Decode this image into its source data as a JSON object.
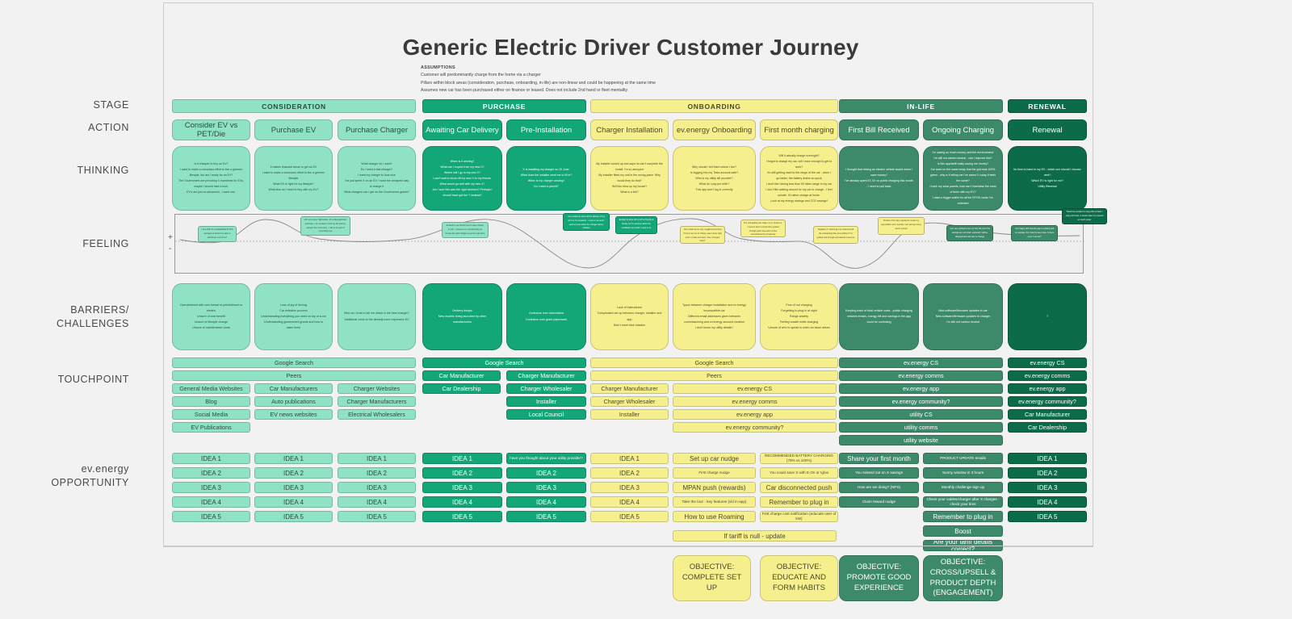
{
  "header": {
    "title": "Generic Electric Driver Customer Journey",
    "assumptions_heading": "ASSUMPTIONS",
    "assumptions": [
      "Customer will predominantly charge from the home via a charger",
      "Pillars within block areas (consideration, purchase, onboarding, in-life) are non-linear and could be happening at the same time",
      "Assumes new car has been purchased either on finance or leased. Does not include 2nd hand or fleet mentality"
    ]
  },
  "row_labels": {
    "stage": "STAGE",
    "action": "ACTION",
    "thinking": "THINKING",
    "feeling": "FEELING",
    "barriers": "BARRIERS/\nCHALLENGES",
    "touchpoint": "TOUCHPOINT",
    "opportunity": "ev.energy\nOPPORTUNITY"
  },
  "colors": {
    "mint": "#8fe3c4",
    "green": "#12a678",
    "yellow": "#f6ef8e",
    "sage": "#3d8a6b",
    "dark": "#0c6b49",
    "board_bg": "#f2f2f2"
  },
  "stages": [
    {
      "label": "CONSIDERATION",
      "theme": "mint"
    },
    {
      "label": "PURCHASE",
      "theme": "green"
    },
    {
      "label": "ONBOARDING",
      "theme": "yellow"
    },
    {
      "label": "IN-LIFE",
      "theme": "sage"
    },
    {
      "label": "RENEWAL",
      "theme": "dark"
    }
  ],
  "actions": [
    {
      "label": "Consider EV vs PET/Die",
      "theme": "mint"
    },
    {
      "label": "Purchase EV",
      "theme": "mint"
    },
    {
      "label": "Purchase Charger",
      "theme": "mint"
    },
    {
      "label": "Awaiting Car Delivery",
      "theme": "green"
    },
    {
      "label": "Pre-Installation",
      "theme": "green"
    },
    {
      "label": "Charger Installation",
      "theme": "yellow"
    },
    {
      "label": "ev.energy Onboarding",
      "theme": "yellow"
    },
    {
      "label": "First month charging",
      "theme": "yellow"
    },
    {
      "label": "First Bill Received",
      "theme": "sage"
    },
    {
      "label": "Ongoing Charging",
      "theme": "sage"
    },
    {
      "label": "Renewal",
      "theme": "dark"
    }
  ],
  "thinking": [
    {
      "theme": "mint",
      "lines": [
        "Is it cheaper to buy an EV?",
        "I want to make a conscious effort to live a greener lifestyle, but am I ready for an EV?",
        "The Government are providing X incentives for EVs, maybe I should take a look.",
        "EV's are just so advanced - I want one."
      ]
    },
    {
      "theme": "mint",
      "lines": [
        "It makes financial sense to get an EV",
        "I want to make a conscious effort to live a greener lifestyle",
        "What EV is right for my lifestyle?",
        "What else do I need to buy with my EV?"
      ]
    },
    {
      "theme": "mint",
      "lines": [
        "What charger do I want?",
        "Do I need a fast charger?",
        "I want my charger to look nice",
        "I've just spent X on an EV, I want the cheapest way to charge it",
        "What chargers can I get on the Government grants?"
      ]
    },
    {
      "theme": "green",
      "lines": [
        "When is it arriving?",
        "What can I expect from my new X?",
        "Where will I go in my new X?",
        "I can't wait to show off my new X to my friends.",
        "What would go well with my new X?",
        "Am I sure this was the right decision? Perhaps I should have got the Y instead?"
      ]
    },
    {
      "theme": "green",
      "lines": [
        "X is installing my charger on 20 June.",
        "What does the installer want me to fill in?",
        "When is my charger arriving?",
        "Do I need a permit?"
      ]
    },
    {
      "theme": "yellow",
      "lines": [
        "My installer turned up and says he can't complete the install. I'm so annoyed",
        "My installer fitted my unit in the wrong place. Why would they do that?",
        "Will this blow up my house?",
        "What is a kW?"
      ]
    },
    {
      "theme": "yellow",
      "lines": [
        "Why should I tell them where I live?",
        "Is logging into my Tesla account safe?",
        "Who is my utility bill provider?",
        "What do I pay per kWh?",
        "This app won't log in correctly"
      ]
    },
    {
      "theme": "yellow",
      "lines": [
        "Will it actually charge overnight?",
        "I forgot to charge my car, will I have enough to get to work?",
        "I'm still getting used to the range of the car - when I go faster, the battery drains so quick",
        "I don't like having less than 50 miles range in my car",
        "I don't like waiting around for my car to charge - I feel unsafe. I'd rather charge at home.",
        "Look at my energy savings and CO2 savings!"
      ]
    },
    {
      "theme": "sage",
      "lines": [
        "I thought that driving an electric vehicle would mean I save money?",
        "I've already spent £X.XX on public charging this month - I need to pull back."
      ]
    },
    {
      "theme": "sage",
      "lines": [
        "I'm saving so much money, and the environment!",
        "I'm still not carbon neutral - can I improve this?",
        "Is this app/tariff really saving me money?",
        "I've seen on the news today that the grid was 100% green - why is it telling me I've saved X today it feels the same?",
        "I have my solar panels, how can I maximise the most of them with my EV?",
        "I want a bigger wallet for all the EPOD cards I've collected"
      ]
    },
    {
      "theme": "dark",
      "lines": [
        "Its time to hand in my EV - which one should I choose next?",
        "Which EV is right for me?",
        "Utility Renewal"
      ]
    }
  ],
  "feeling": {
    "axis_plus": "+",
    "axis_minus": "-",
    "bubbles": [
      {
        "theme": "mint",
        "text": "I love both the sustainability & TCO savings but would I be able to afford/use it at home?"
      },
      {
        "theme": "mint",
        "text": "EV's are super high/visible. It's a lifestyle/brand purchase, I am excited to start my EV journey and join the community - I like to be part of something new"
      },
      {
        "theme": "mint",
        "text": "Excited to use the EV and to have chosen my EV - however it is overwhelming to choose the right charger & get the right price"
      },
      {
        "theme": "green",
        "text": "I am excited to show off the delivery of my EV but I'm impatient - I want it now and I want to know when the charger will be installed"
      },
      {
        "theme": "green",
        "text": "Excited to show off my EV to friends & family, but I'm anxious about the installation and what I need to do"
      },
      {
        "theme": "yellow",
        "text": "The install can be very negative/unnerving if I feel I am not in charge, was it done right and is it safe and have I been charged fairly?"
      },
      {
        "theme": "yellow",
        "text": "The onboarding can make me or break me, I need to feel in control & be guided through each step and not feel overwhelmed by complexity"
      },
      {
        "theme": "yellow",
        "text": "Negative if I cannot get my head around the onboarding flow, but positive if I'm guided well through educational resources"
      },
      {
        "theme": "yellow",
        "text": "Positive if the app experience meets my expectation and I feel like I am saving money and in control"
      },
      {
        "theme": "sage",
        "text": "I am very excited to see my first bill, but if the savings are not what I expected I will be disappointed and look to change"
      },
      {
        "theme": "sage",
        "text": "I am happy with how the app is working and my savings, but I want to see more. Is there more I can do?"
      },
      {
        "theme": "dark",
        "text": "Would be excellent to stay with a brand I enjoy and trust, it would make my renewal so much easier"
      }
    ]
  },
  "barriers": [
    {
      "theme": "mint",
      "lines": [
        "Overwhelmed with new format of petrol/diesel vs electric",
        "Unsure of cost benefit",
        "Unsure of lifestyle change",
        "Unsure of maintenance costs"
      ]
    },
    {
      "theme": "mint",
      "lines": [
        "Loss of joy of driving",
        "Car selection process",
        "Understanding everything you need on top of a car",
        "Understanding government grants and how to claim them"
      ]
    },
    {
      "theme": "mint",
      "lines": [
        "Who do I trust to tell me which is the best charger?",
        "Additional costs to the already more expensive EV"
      ]
    },
    {
      "theme": "green",
      "lines": [
        "Delivery delays",
        "New models being launched by other manufacturers"
      ]
    },
    {
      "theme": "green",
      "lines": [
        "Confusion over instructions",
        "Confusion over grant paperwork"
      ]
    },
    {
      "theme": "yellow",
      "lines": [
        "Lack of instructions",
        "Complicated set up between charger, installer and app",
        "Didn't meet their installer"
      ]
    },
    {
      "theme": "yellow",
      "lines": [
        "Typos between charger installation and ev.energy",
        "Incompatible car",
        "Different email addresses given between commissioning and ev.energy account creation",
        "I don't know my utility details?"
      ]
    },
    {
      "theme": "yellow",
      "lines": [
        "Fear of not charging",
        "Forgetting to plug in at night",
        "Range anxiety",
        "Feeling unsafe while charging",
        "Unsure of who to speak to when an issue arises"
      ]
    },
    {
      "theme": "sage",
      "lines": [
        "Keeping track of total vehicle costs - public charging network emails, energy bill and savings in the app could be confusing"
      ]
    },
    {
      "theme": "sage",
      "lines": [
        "New software/firmware updates to car",
        "New software/firmware updates to charger",
        "I'm still not carbon neutral"
      ]
    },
    {
      "theme": "dark",
      "lines": [
        "?"
      ]
    }
  ],
  "touchpoints": {
    "wide": [
      {
        "label": "Google Search",
        "theme": "mint",
        "group": "consideration"
      },
      {
        "label": "Peers",
        "theme": "mint",
        "group": "consideration"
      },
      {
        "label": "Google Search",
        "theme": "green",
        "group": "purchase"
      },
      {
        "label": "Google Search",
        "theme": "yellow",
        "group": "onboarding"
      },
      {
        "label": "Peers",
        "theme": "yellow",
        "group": "onboarding"
      }
    ],
    "columns": [
      {
        "theme": "mint",
        "items": [
          "General Media Websites",
          "Blog",
          "Social Media",
          "EV Publications"
        ]
      },
      {
        "theme": "mint",
        "items": [
          "Car Manufacturers",
          "Auto publications",
          "EV news websites"
        ]
      },
      {
        "theme": "mint",
        "items": [
          "Charger Websites",
          "Charger Manufacturers",
          "Electrical Wholesalers"
        ]
      },
      {
        "theme": "green",
        "items": [
          "Car Manufacturer",
          "Car Dealership"
        ]
      },
      {
        "theme": "green",
        "items": [
          "Charger Manufacturer",
          "Charger Wholesaler",
          "Installer",
          "Local Council"
        ]
      },
      {
        "theme": "yellow",
        "items": [
          "Charger Manufacturer",
          "Charger Wholesaler",
          "Installer"
        ]
      },
      {
        "theme": "yellow",
        "items": [
          "ev.energy CS",
          "ev.energy comms",
          "ev.energy app",
          "ev.energy community?"
        ]
      },
      {
        "theme": "sage",
        "items": [
          "ev.energy CS",
          "ev.energy comms",
          "ev.energy app",
          "ev.energy community?",
          "utility CS",
          "utility comms",
          "utility website"
        ]
      },
      {
        "theme": "dark",
        "items": [
          "ev.energy CS",
          "ev.energy comms",
          "ev.energy app",
          "ev.energy community?",
          "Car Manufacturer",
          "Car Dealership"
        ]
      }
    ]
  },
  "opportunities": [
    {
      "theme": "mint",
      "items": [
        {
          "label": "IDEA 1"
        },
        {
          "label": "IDEA 2"
        },
        {
          "label": "IDEA 3"
        },
        {
          "label": "IDEA 4"
        },
        {
          "label": "IDEA 5"
        }
      ]
    },
    {
      "theme": "mint",
      "items": [
        {
          "label": "IDEA 1"
        },
        {
          "label": "IDEA 2"
        },
        {
          "label": "IDEA 3"
        },
        {
          "label": "IDEA 4"
        },
        {
          "label": "IDEA 5"
        }
      ]
    },
    {
      "theme": "mint",
      "items": [
        {
          "label": "IDEA 1"
        },
        {
          "label": "IDEA 2"
        },
        {
          "label": "IDEA 3"
        },
        {
          "label": "IDEA 4"
        },
        {
          "label": "IDEA 5"
        }
      ]
    },
    {
      "theme": "green",
      "items": [
        {
          "label": "IDEA 1"
        },
        {
          "label": "IDEA 2"
        },
        {
          "label": "IDEA 3"
        },
        {
          "label": "IDEA 4"
        },
        {
          "label": "IDEA 5"
        }
      ]
    },
    {
      "theme": "green",
      "items": [
        {
          "label": "have you thought about your utility provider?",
          "small": true
        },
        {
          "label": "IDEA 2"
        },
        {
          "label": "IDEA 3"
        },
        {
          "label": "IDEA 4"
        },
        {
          "label": "IDEA 5"
        }
      ]
    },
    {
      "theme": "yellow",
      "items": [
        {
          "label": "IDEA 1"
        },
        {
          "label": "IDEA 2"
        },
        {
          "label": "IDEA 3"
        },
        {
          "label": "IDEA 4"
        },
        {
          "label": "IDEA 5"
        }
      ]
    },
    {
      "theme": "yellow",
      "items": [
        {
          "label": "Set up car nudge"
        },
        {
          "label": "First charge nudge",
          "small": true
        },
        {
          "label": "MPAN push (rewards)"
        },
        {
          "label": "Take the tour - key features (vid in-app)",
          "small": true
        },
        {
          "label": "How to use Roaming"
        }
      ]
    },
    {
      "theme": "yellow",
      "items": [
        {
          "label": "RECOMMENDED BATTERY CHARGING (75% vs 100%)",
          "small": true
        },
        {
          "label": "You could save X with E.On or Igloo",
          "small": true
        },
        {
          "label": "Car disconnected push"
        },
        {
          "label": "Remember to plug in"
        },
        {
          "label": "First charge cost notification (educate user of kW)",
          "small": true
        }
      ]
    },
    {
      "theme": "sage",
      "items": [
        {
          "label": "Share your first month"
        },
        {
          "label": "You missed out on X savings",
          "small": true
        },
        {
          "label": "How are we doing? (NPS)",
          "small": true
        },
        {
          "label": "Claim reward nudge",
          "small": true
        }
      ]
    },
    {
      "theme": "sage",
      "items": [
        {
          "label": "PRODUCT UPDATE emails",
          "small": true
        },
        {
          "label": "Sunny window in 3 hours",
          "small": true
        },
        {
          "label": "Monthly challenge sign up",
          "small": true
        },
        {
          "label": "Check your cables/charger after X charges - check your tires",
          "small": true
        },
        {
          "label": "Remember to plug in"
        },
        {
          "label": "Boost"
        },
        {
          "label": "Are your tariff details correct?"
        }
      ]
    },
    {
      "theme": "dark",
      "items": [
        {
          "label": "IDEA 1"
        },
        {
          "label": "IDEA 2"
        },
        {
          "label": "IDEA 3"
        },
        {
          "label": "IDEA 4"
        },
        {
          "label": "IDEA 5"
        }
      ]
    }
  ],
  "tariff_note": {
    "label": "If tariff is null - update",
    "theme": "yellow"
  },
  "objectives": [
    {
      "theme": "yellow",
      "lines": [
        "OBJECTIVE:",
        "COMPLETE SET UP"
      ]
    },
    {
      "theme": "yellow",
      "lines": [
        "OBJECTIVE:",
        "EDUCATE AND",
        "FORM HABITS"
      ]
    },
    {
      "theme": "sage",
      "lines": [
        "OBJECTIVE:",
        "PROMOTE GOOD",
        "EXPERIENCE"
      ]
    },
    {
      "theme": "sage",
      "lines": [
        "OBJECTIVE:",
        "CROSS/UPSELL &",
        "PRODUCT DEPTH",
        "(ENGAGEMENT)"
      ]
    }
  ]
}
